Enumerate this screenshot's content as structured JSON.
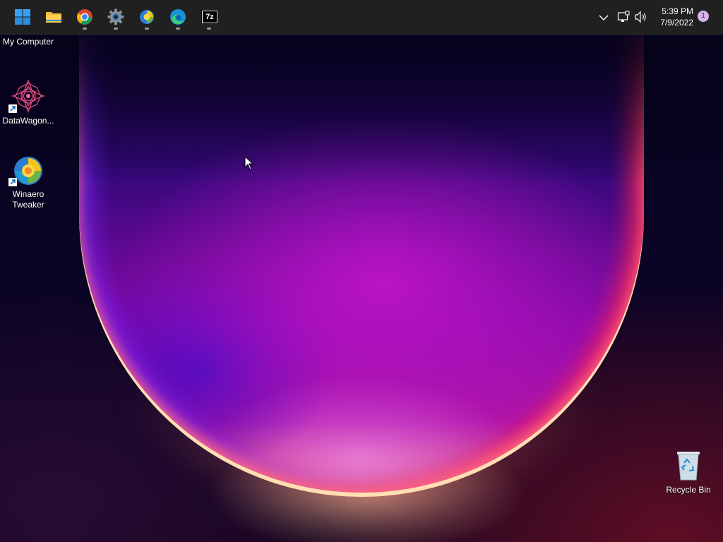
{
  "taskbar": {
    "apps": [
      {
        "name": "start-button",
        "icon": "windows-logo-icon"
      },
      {
        "name": "file-explorer",
        "icon": "folder-icon"
      },
      {
        "name": "chrome",
        "icon": "chrome-icon"
      },
      {
        "name": "settings",
        "icon": "gear-icon"
      },
      {
        "name": "winaero-tweaker",
        "icon": "winaero-tweaker-icon"
      },
      {
        "name": "edge",
        "icon": "edge-icon"
      },
      {
        "name": "7zip",
        "icon": "7zip-icon",
        "text": "7z"
      }
    ],
    "tray": {
      "clock_time": "5:39 PM",
      "clock_date": "7/9/2022",
      "notification_count": "1"
    }
  },
  "desktop": {
    "icons": [
      {
        "label": "My Computer"
      },
      {
        "label": "DataWagon..."
      },
      {
        "label_line1": "Winaero",
        "label_line2": "Tweaker"
      },
      {
        "label": "Recycle Bin"
      }
    ]
  },
  "colors": {
    "taskbar_bg": "#202020",
    "accent": "#0078d4"
  }
}
